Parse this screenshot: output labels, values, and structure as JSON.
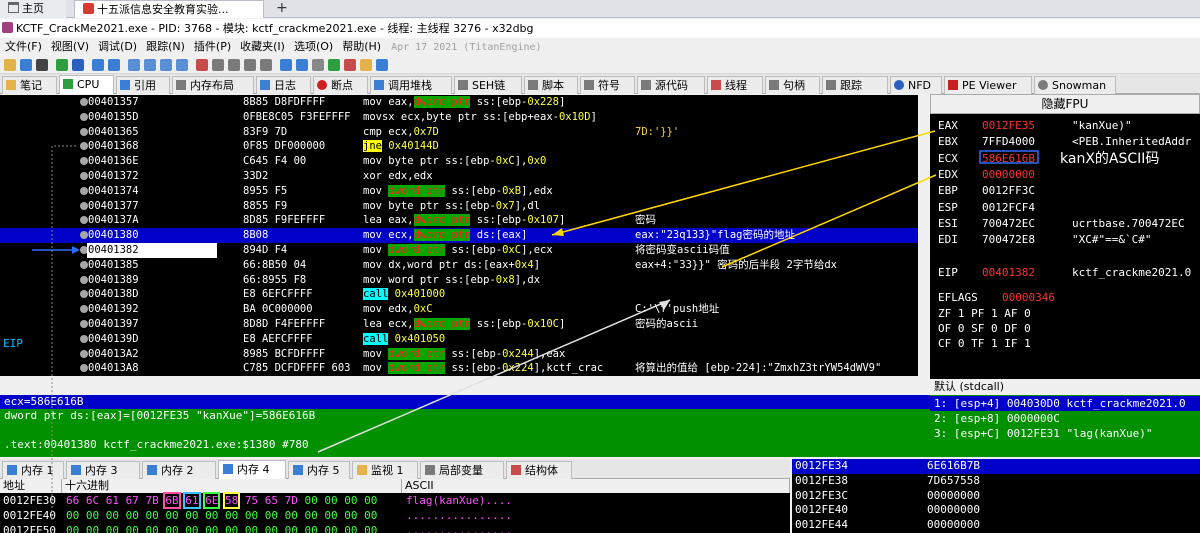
{
  "browser": {
    "tabs": [
      {
        "label": "主页"
      },
      {
        "label": "十五派信息安全教育实验..."
      }
    ],
    "add_tab": "+"
  },
  "window": {
    "title": "KCTF_CrackMe2021.exe - PID: 3768 - 模块: kctf_crackme2021.exe - 线程: 主线程 3276 - x32dbg"
  },
  "menu": {
    "items": [
      "文件(F)",
      "视图(V)",
      "调试(D)",
      "跟踪(N)",
      "插件(P)",
      "收藏夹(I)",
      "选项(O)",
      "帮助(H)"
    ],
    "build_date": "Apr 17 2021 (TitanEngine)"
  },
  "view_tabs": [
    "笔记",
    "CPU",
    "引用",
    "内存布局",
    "日志",
    "断点",
    "调用堆栈",
    "SEH链",
    "脚本",
    "符号",
    "源代码",
    "线程",
    "句柄",
    "跟踪",
    "NFD",
    "PE Viewer",
    "Snowman"
  ],
  "disasm": {
    "eip_tag": "EIP",
    "rows": [
      {
        "addr": "00401357",
        "bytes": "8B85 D8FDFFFF",
        "instr": [
          [
            "mov eax,",
            ""
          ],
          [
            "dword ptr",
            "kw"
          ],
          [
            " ss:[ebp-",
            ""
          ],
          [
            "0x228",
            "imm"
          ],
          [
            "]",
            ""
          ]
        ],
        "comment": ""
      },
      {
        "addr": "0040135D",
        "bytes": "0FBE8C05 F3FEFFFF",
        "instr": [
          [
            "movsx ecx,byte ptr ss:[ebp+eax-",
            ""
          ],
          [
            "0x10D",
            "imm"
          ],
          [
            "]",
            ""
          ]
        ],
        "comment": ""
      },
      {
        "addr": "00401365",
        "bytes": "83F9 7D",
        "instr": [
          [
            "cmp ecx,",
            ""
          ],
          [
            "0x7D",
            "imm"
          ]
        ],
        "comment": "7D:'}}'"
      },
      {
        "addr": "00401368",
        "bytes": "0F85 DF000000",
        "instr": [
          [
            "jne",
            "jmp"
          ],
          [
            " ",
            ""
          ],
          [
            "0x40144D",
            "imm"
          ]
        ],
        "comment": ""
      },
      {
        "addr": "0040136E",
        "bytes": "C645 F4 00",
        "instr": [
          [
            "mov byte ptr ss:[ebp-",
            ""
          ],
          [
            "0xC",
            "imm"
          ],
          [
            "],",
            ""
          ],
          [
            "0x0",
            "imm"
          ]
        ],
        "comment": ""
      },
      {
        "addr": "00401372",
        "bytes": "33D2",
        "instr": [
          [
            "xor edx,edx",
            ""
          ]
        ],
        "comment": ""
      },
      {
        "addr": "00401374",
        "bytes": "8955 F5",
        "instr": [
          [
            "mov ",
            ""
          ],
          [
            "dword ptr",
            "kw"
          ],
          [
            " ss:[ebp-",
            ""
          ],
          [
            "0xB",
            "imm"
          ],
          [
            "],edx",
            ""
          ]
        ],
        "comment": ""
      },
      {
        "addr": "00401377",
        "bytes": "8855 F9",
        "instr": [
          [
            "mov byte ptr ss:[ebp-",
            ""
          ],
          [
            "0x7",
            "imm"
          ],
          [
            "],dl",
            ""
          ]
        ],
        "comment": ""
      },
      {
        "addr": "0040137A",
        "bytes": "8D85 F9FEFFFF",
        "instr": [
          [
            "lea eax,",
            ""
          ],
          [
            "dword ptr",
            "kw"
          ],
          [
            " ss:[ebp-",
            ""
          ],
          [
            "0x107",
            "imm"
          ],
          [
            "]",
            ""
          ]
        ],
        "comment": "密码"
      },
      {
        "addr": "00401380",
        "bytes": "8B08",
        "instr": [
          [
            "mov ecx,",
            ""
          ],
          [
            "dword ptr",
            "kw"
          ],
          [
            " ds:[eax]",
            ""
          ]
        ],
        "comment": "eax:\"23q133}\"flag密码的地址",
        "selected": true
      },
      {
        "addr": "00401382",
        "bytes": "894D F4",
        "instr": [
          [
            "mov ",
            ""
          ],
          [
            "dword ptr",
            "kw"
          ],
          [
            " ss:[ebp-",
            ""
          ],
          [
            "0xC",
            "imm"
          ],
          [
            "],ecx",
            ""
          ]
        ],
        "comment": "将密码变ascii码值",
        "eip": true
      },
      {
        "addr": "00401385",
        "bytes": "66:8B50 04",
        "instr": [
          [
            "mov dx,word ptr ds:[eax+",
            ""
          ],
          [
            "0x4",
            "imm"
          ],
          [
            "]",
            ""
          ]
        ],
        "comment": "eax+4:\"33}}\" 密码的后半段 2字节给dx"
      },
      {
        "addr": "00401389",
        "bytes": "66:8955 F8",
        "instr": [
          [
            "mov word ptr ss:[ebp-",
            ""
          ],
          [
            "0x8",
            "imm"
          ],
          [
            "],dx",
            ""
          ]
        ],
        "comment": ""
      },
      {
        "addr": "0040138D",
        "bytes": "E8 6EFCFFFF",
        "instr": [
          [
            "call",
            "call"
          ],
          [
            " ",
            ""
          ],
          [
            "0x401000",
            "imm"
          ]
        ],
        "comment": ""
      },
      {
        "addr": "00401392",
        "bytes": "BA 0C000000",
        "instr": [
          [
            "mov edx,",
            ""
          ],
          [
            "0xC",
            "imm"
          ]
        ],
        "comment": "C:'\\f'push地址"
      },
      {
        "addr": "00401397",
        "bytes": "8D8D F4FEFFFF",
        "instr": [
          [
            "lea ecx,",
            ""
          ],
          [
            "dword ptr",
            "kw"
          ],
          [
            " ss:[ebp-",
            ""
          ],
          [
            "0x10C",
            "imm"
          ],
          [
            "]",
            ""
          ]
        ],
        "comment": "密码的ascii"
      },
      {
        "addr": "0040139D",
        "bytes": "E8 AEFCFFFF",
        "instr": [
          [
            "call",
            "call"
          ],
          [
            " ",
            ""
          ],
          [
            "0x401050",
            "imm"
          ]
        ],
        "comment": ""
      },
      {
        "addr": "004013A2",
        "bytes": "8985 BCFDFFFF",
        "instr": [
          [
            "mov ",
            ""
          ],
          [
            "dword ptr",
            "kw"
          ],
          [
            " ss:[ebp-",
            ""
          ],
          [
            "0x244",
            "imm"
          ],
          [
            "],eax",
            ""
          ]
        ],
        "comment": ""
      },
      {
        "addr": "004013A8",
        "bytes": "C785 DCFDFFFF 603",
        "instr": [
          [
            "mov ",
            ""
          ],
          [
            "dword ptr",
            "kw"
          ],
          [
            " ss:[ebp-",
            ""
          ],
          [
            "0x224",
            "imm"
          ],
          [
            "],kctf_crac",
            ""
          ]
        ],
        "comment": "将算出的值给 [ebp-224]:\"ZmxhZ3trYW54dWV9\""
      }
    ]
  },
  "info": {
    "ecx": "ecx=586E616B",
    "line1": "dword ptr ds:[eax]=[0012FE35 \"kanXue\"]=586E616B",
    "line2": ".text:00401380 kctf_crackme2021.exe:$1380 #780"
  },
  "registers": {
    "fpu_button": "隐藏FPU",
    "ecx_note": "kanX的ASCII码",
    "rows": [
      {
        "name": "EAX",
        "value": "0012FE35",
        "comment": "\"kanXue)\"",
        "changed": true
      },
      {
        "name": "EBX",
        "value": "7FFD4000",
        "comment": "<PEB.InheritedAddr"
      },
      {
        "name": "ECX",
        "value": "586E616B",
        "comment": "",
        "changed": true
      },
      {
        "name": "EDX",
        "value": "00000000",
        "comment": "",
        "changed": true
      },
      {
        "name": "EBP",
        "value": "0012FF3C",
        "comment": ""
      },
      {
        "name": "ESP",
        "value": "0012FCF4",
        "comment": ""
      },
      {
        "name": "ESI",
        "value": "700472EC",
        "comment": "ucrtbase.700472EC"
      },
      {
        "name": "EDI",
        "value": "700472E8",
        "comment": "\"XC#\"==&`C#\""
      },
      {
        "name": "",
        "value": "",
        "comment": ""
      },
      {
        "name": "EIP",
        "value": "00401382",
        "comment": "kctf_crackme2021.0",
        "changed": true
      }
    ],
    "eflags_label": "EFLAGS",
    "eflags_value": "00000346",
    "flags": [
      "ZF 1   PF 1   AF 0",
      "OF 0   SF 0   DF 0",
      "CF 0   TF 1   IF 1"
    ]
  },
  "call_stack": {
    "title": "默认 (stdcall)",
    "rows": [
      "1: [esp+4] 004030D0 kctf_crackme2021.0",
      "2: [esp+8] 0000000C",
      "3: [esp+C] 0012FE31 \"lag(kanXue)\""
    ]
  },
  "bottom_tabs": [
    "内存 1",
    "内存 3",
    "内存 2",
    "内存 4",
    "内存 5",
    "监视 1",
    "局部变量",
    "结构体"
  ],
  "dump": {
    "headers": [
      "地址",
      "十六进制",
      "ASCII"
    ],
    "rows": [
      {
        "addr": "0012FE30",
        "hex": [
          "66",
          "6C",
          "61",
          "67",
          "7B",
          "6B",
          "61",
          "6E",
          "58",
          "75",
          "65",
          "7D",
          "00",
          "00",
          "00",
          "00"
        ],
        "ascii": "flag(kanXue)...."
      },
      {
        "addr": "0012FE40",
        "hex": [
          "00",
          "00",
          "00",
          "00",
          "00",
          "00",
          "00",
          "00",
          "00",
          "00",
          "00",
          "00",
          "00",
          "00",
          "00",
          "00"
        ],
        "ascii": "................"
      },
      {
        "addr": "0012FE50",
        "hex": [
          "00",
          "00",
          "00",
          "00",
          "00",
          "00",
          "00",
          "00",
          "00",
          "00",
          "00",
          "00",
          "00",
          "00",
          "00",
          "00"
        ],
        "ascii": "................"
      }
    ]
  },
  "stack": {
    "rows": [
      {
        "addr": "0012FE34",
        "value": "6E616B7B"
      },
      {
        "addr": "0012FE38",
        "value": "7D657558"
      },
      {
        "addr": "0012FE3C",
        "value": "00000000"
      },
      {
        "addr": "0012FE40",
        "value": "00000000"
      },
      {
        "addr": "0012FE44",
        "value": "00000000"
      }
    ]
  },
  "colors": {
    "accent_blue": "#0000c8",
    "highlight_green": "#009000",
    "changed_red": "#ff3030"
  }
}
